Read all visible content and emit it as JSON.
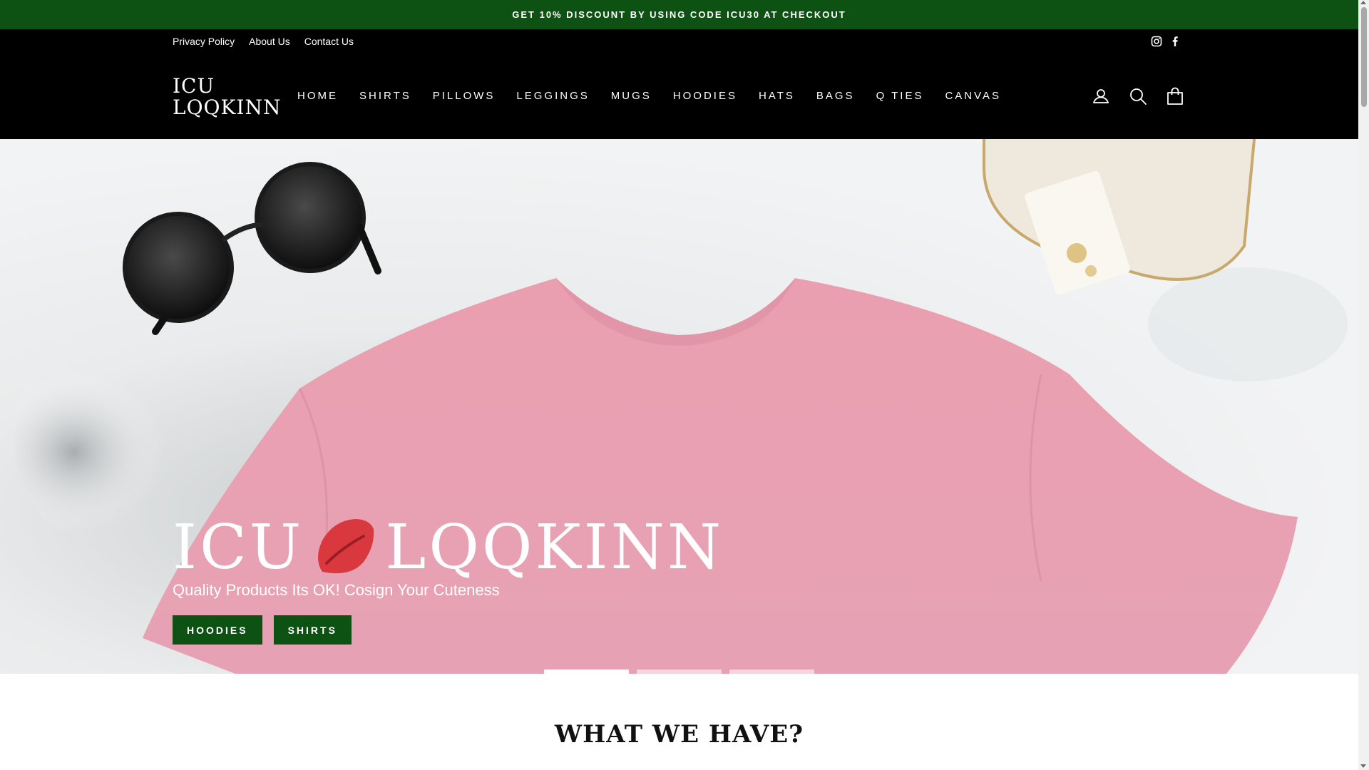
{
  "announcement": {
    "text": "GET 10% DISCOUNT BY USING CODE ICU30 AT CHECKOUT"
  },
  "utility": {
    "links": [
      "Privacy Policy",
      "About Us",
      "Contact Us"
    ],
    "social": [
      {
        "icon": "instagram-icon"
      },
      {
        "icon": "facebook-icon"
      }
    ]
  },
  "header": {
    "logo_line1": "ICU",
    "logo_line2": "LQQKINN",
    "nav": [
      "HOME",
      "SHIRTS",
      "PILLOWS",
      "LEGGINGS",
      "MUGS",
      "HOODIES",
      "HATS",
      "BAGS",
      "Q TIES",
      "CANVAS"
    ],
    "icons": [
      "account-icon",
      "search-icon",
      "cart-icon"
    ]
  },
  "hero": {
    "brand_left": "ICU",
    "brand_right": "LQQKINN",
    "tagline": "Quality Products Its OK! Cosign Your Cuteness",
    "buttons": [
      "HOODIES",
      "SHIRTS"
    ],
    "slides": 3,
    "active_slide": 1
  },
  "sections": {
    "title": "WHAT WE HAVE?"
  },
  "colors": {
    "accent": "#0e5213",
    "header_bg": "#000000",
    "shirt": "#e9a1b0",
    "lips": "#d9383f"
  }
}
